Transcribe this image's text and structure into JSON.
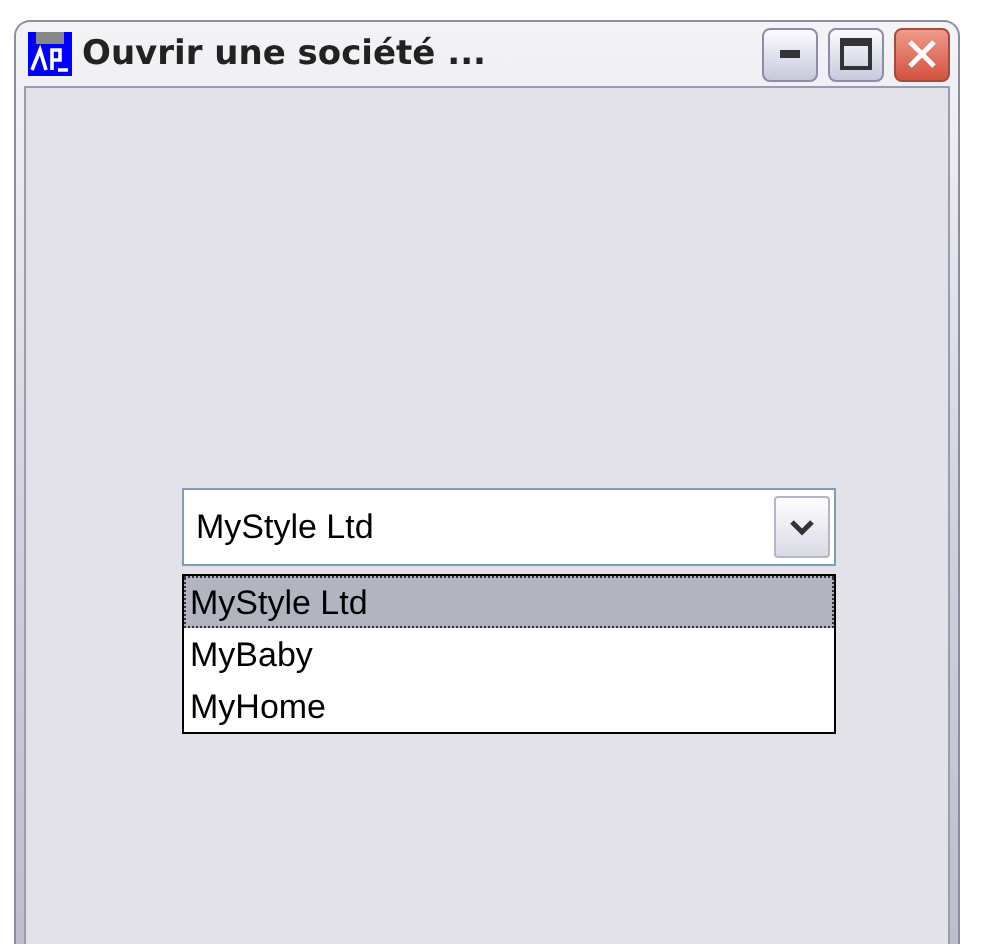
{
  "window": {
    "title": "Ouvrir une société ..."
  },
  "combo": {
    "value": "MyStyle Ltd",
    "expanded": true,
    "options": [
      {
        "label": "MyStyle Ltd",
        "selected": true
      },
      {
        "label": "MyBaby",
        "selected": false
      },
      {
        "label": "MyHome",
        "selected": false
      }
    ]
  }
}
